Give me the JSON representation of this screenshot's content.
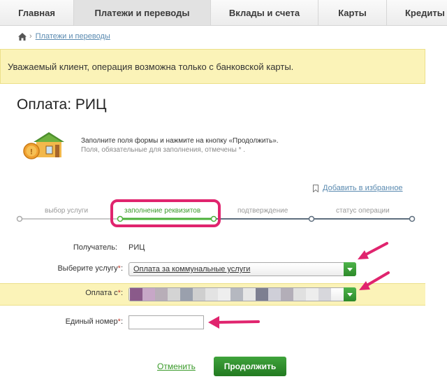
{
  "nav": {
    "tabs": [
      {
        "label": "Главная"
      },
      {
        "label": "Платежи и переводы"
      },
      {
        "label": "Вклады и счета"
      },
      {
        "label": "Карты"
      },
      {
        "label": "Кредиты"
      }
    ]
  },
  "breadcrumb": {
    "item": "Платежи и переводы"
  },
  "notice": {
    "text": "Уважаемый клиент, операция возможна только с банковской карты."
  },
  "page": {
    "title": "Оплата: РИЦ"
  },
  "info": {
    "line1": "Заполните поля формы и нажмите на кнопку «Продолжить».",
    "line2": "Поля, обязательные для заполнения, отмечены * ."
  },
  "favorites": {
    "label": "Добавить в избранное"
  },
  "steps": [
    {
      "label": "выбор услуги",
      "state": "done"
    },
    {
      "label": "заполнение реквизитов",
      "state": "active"
    },
    {
      "label": "подтверждение",
      "state": "pending"
    },
    {
      "label": "статус операции",
      "state": "pending"
    }
  ],
  "form": {
    "recipient_label": "Получатель:",
    "recipient_value": "РИЦ",
    "service_label": "Выберите услугу",
    "service_value": "Оплата за коммунальные услуги",
    "payfrom_label": "Оплата с",
    "number_label": "Единый номер",
    "number_value": "",
    "required_mark": "*",
    "colon": ":"
  },
  "actions": {
    "cancel": "Отменить",
    "continue": "Продолжить"
  },
  "colors": {
    "accent_green": "#3a9a2a",
    "highlight": "#e0246e",
    "notice_bg": "#fbf3b8",
    "link": "#5a8ab0"
  },
  "icons": [
    "home-icon",
    "house-ruble-icon",
    "bookmark-icon",
    "dropdown-arrow-icon"
  ]
}
